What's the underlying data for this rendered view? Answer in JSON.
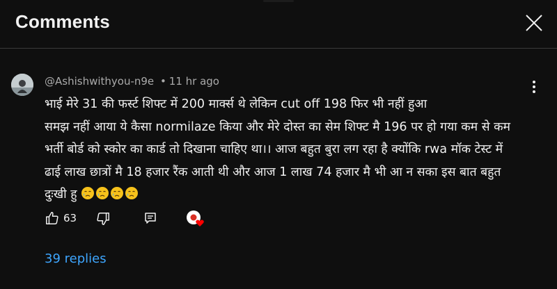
{
  "header": {
    "title": "Comments",
    "close_icon": "close-icon"
  },
  "comment": {
    "author": "@Ashishwithyou-n9e",
    "separator": "•",
    "time": "11 hr ago",
    "lines": [
      "भाई मेरे 31 की फर्स्ट शिफ्ट में 200 मार्क्स थे लेकिन cut off 198 फिर भी नहीं हुआ",
      "समझ नहीं आया ये कैसा normilaze किया और मेरे दोस्त का सेम शिफ्ट मै 196 पर हो गया कम से कम",
      "भर्ती बोर्ड को स्कोर का कार्ड तो दिखाना चाहिए था।। आज बहुत बुरा लग रहा है क्योंकि rwa मॉक टेस्ट में",
      "ढाई लाख छात्रों मै  18 हजार रैंक आती थी और आज 1 लाख 74 हजार मै भी आ  न सका इस बात बहुत",
      "दुःखी हु"
    ],
    "emojis": [
      "crying-face-emoji",
      "crying-face-emoji",
      "crying-face-emoji",
      "crying-face-emoji"
    ],
    "like_count": "63",
    "icons": {
      "like": "thumbs-up-icon",
      "dislike": "thumbs-down-icon",
      "reply": "reply-icon",
      "creator_heart": "creator-heart-icon",
      "more": "more-vertical-icon"
    }
  },
  "replies": {
    "label": "39 replies"
  },
  "colors": {
    "background": "#0f0f0f",
    "text": "#f1f1f1",
    "secondary_text": "#aaaaaa",
    "link": "#3ea6ff",
    "heart": "#ff0000"
  }
}
